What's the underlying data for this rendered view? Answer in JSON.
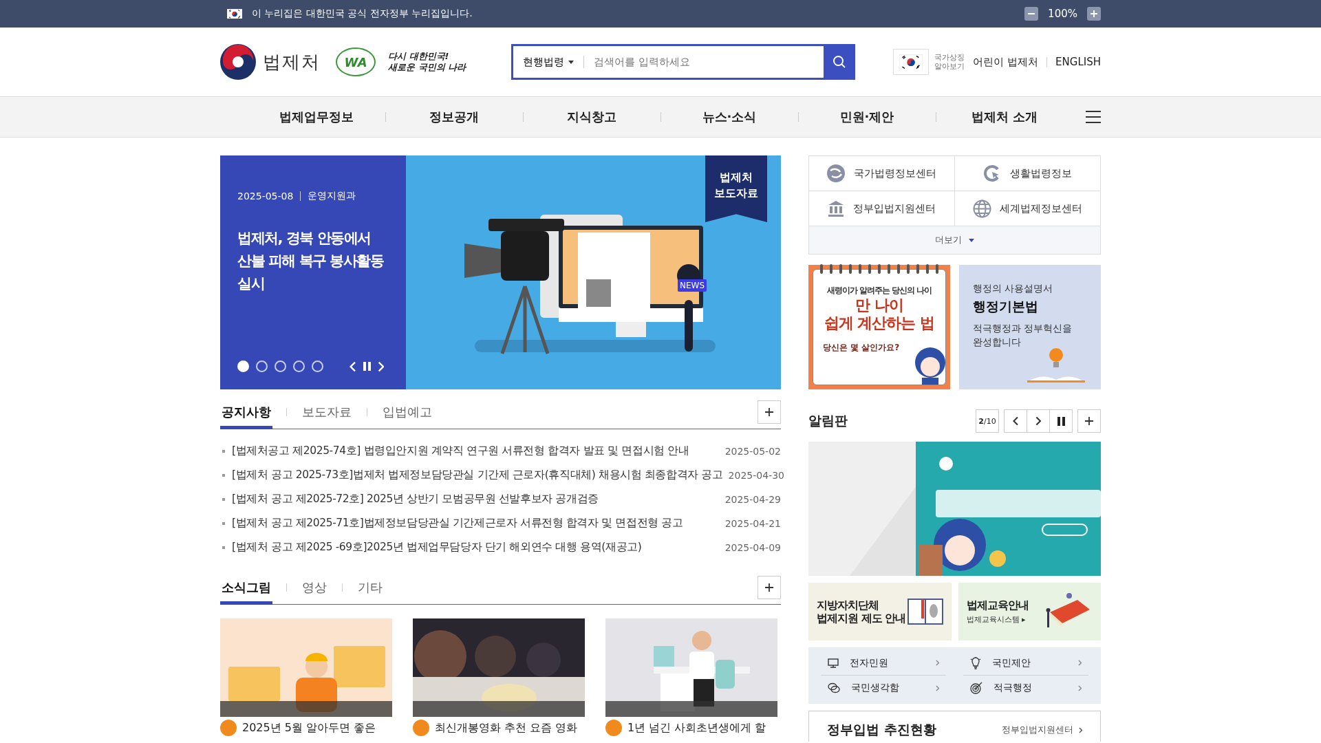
{
  "gov_bar": {
    "text": "이 누리집은 대한민국 공식 전자정부 누리집입니다.",
    "zoom": "100%"
  },
  "header": {
    "logo_text": "법제처",
    "badge_text": "WA",
    "slogan": [
      "다시 대한민국!",
      "새로운 국민의 나라"
    ],
    "search": {
      "scope": "현행법령",
      "placeholder": "검색어를 입력하세요"
    },
    "symbol_label": [
      "국가상징",
      "알아보기"
    ],
    "links": [
      "어린이 법제처",
      "ENGLISH"
    ]
  },
  "nav": [
    "법제업무정보",
    "정보공개",
    "지식창고",
    "뉴스·소식",
    "민원·제안",
    "법제처 소개"
  ],
  "hero": {
    "date": "2025-05-08",
    "dept": "운영지원과",
    "title": "법제처, 경북 안동에서 산불 피해 복구 봉사활동 실시",
    "ribbon": [
      "법제처",
      "보도자료"
    ],
    "news_label": "NEWS",
    "dots": [
      {
        "selected": true
      },
      {
        "selected": false
      },
      {
        "selected": false
      },
      {
        "selected": false
      },
      {
        "selected": false
      }
    ]
  },
  "notice_tabs": [
    {
      "label": "공지사항",
      "selected": true
    },
    {
      "label": "보도자료",
      "selected": false
    },
    {
      "label": "입법예고",
      "selected": false
    }
  ],
  "notices": [
    {
      "title": "[법제처공고 제2025-74호] 법령입안지원 계약직 연구원 서류전형 합격자 발표 및 면접시험 안내",
      "date": "2025-05-02"
    },
    {
      "title": "[법제처 공고 2025-73호]법제처 법제정보담당관실 기간제 근로자(휴직대체) 채용시험 최종합격자 공고",
      "date": "2025-04-30"
    },
    {
      "title": "[법제처 공고 제2025-72호] 2025년 상반기 모범공무원 선발후보자 공개검증",
      "date": "2025-04-29"
    },
    {
      "title": "[법제처 공고 제2025-71호]법제정보담당관실 기간제근로자 서류전형 합격자 및 면접전형 공고",
      "date": "2025-04-21"
    },
    {
      "title": "[법제처 공고 제2025 -69호]2025년 법제업무담당자 단기 해외연수 대행 용역(재공고)",
      "date": "2025-04-09"
    }
  ],
  "news_tabs": [
    {
      "label": "소식그림",
      "selected": true
    },
    {
      "label": "영상",
      "selected": false
    },
    {
      "label": "기타",
      "selected": false
    }
  ],
  "news_cards": [
    {
      "kind": "poster",
      "title": "2025년 5월 알아두면 좋은"
    },
    {
      "kind": "audience",
      "title": "최신개봉영화 추천 요즘 영화"
    },
    {
      "kind": "office",
      "title": "1년 넘긴 사회초년생에게 할"
    }
  ],
  "site_links": [
    "국가법령정보센터",
    "생활법령정보",
    "정부입법지원센터",
    "세계법제정보센터"
  ],
  "more": "더보기",
  "age_banner": {
    "kicker": "새령이가 알려주는 당신의 나이",
    "headline": [
      "만 나이",
      "쉽게 계산하는 법"
    ],
    "question": "당신은 몇 살인가요?"
  },
  "admin_banner": {
    "kicker": "행정의 사용설명서",
    "title": "행정기본법",
    "text": [
      "적극행정과 정부혁신을",
      "완성합니다"
    ]
  },
  "board": {
    "title": "알림판",
    "counter": "**2**/10"
  },
  "small_banners": [
    {
      "kind": "local",
      "title": [
        "지방자치단체",
        "법제지원 제도 안내"
      ]
    },
    {
      "kind": "education",
      "title": [
        "법제교육안내"
      ],
      "sub": "법제교육시스템 ▸"
    }
  ],
  "quick_links": [
    "전자민원",
    "국민제안",
    "국민생각함",
    "적극행정"
  ],
  "legislation": {
    "title": "정부입법 추진현황",
    "link": "정부입법지원센터"
  }
}
